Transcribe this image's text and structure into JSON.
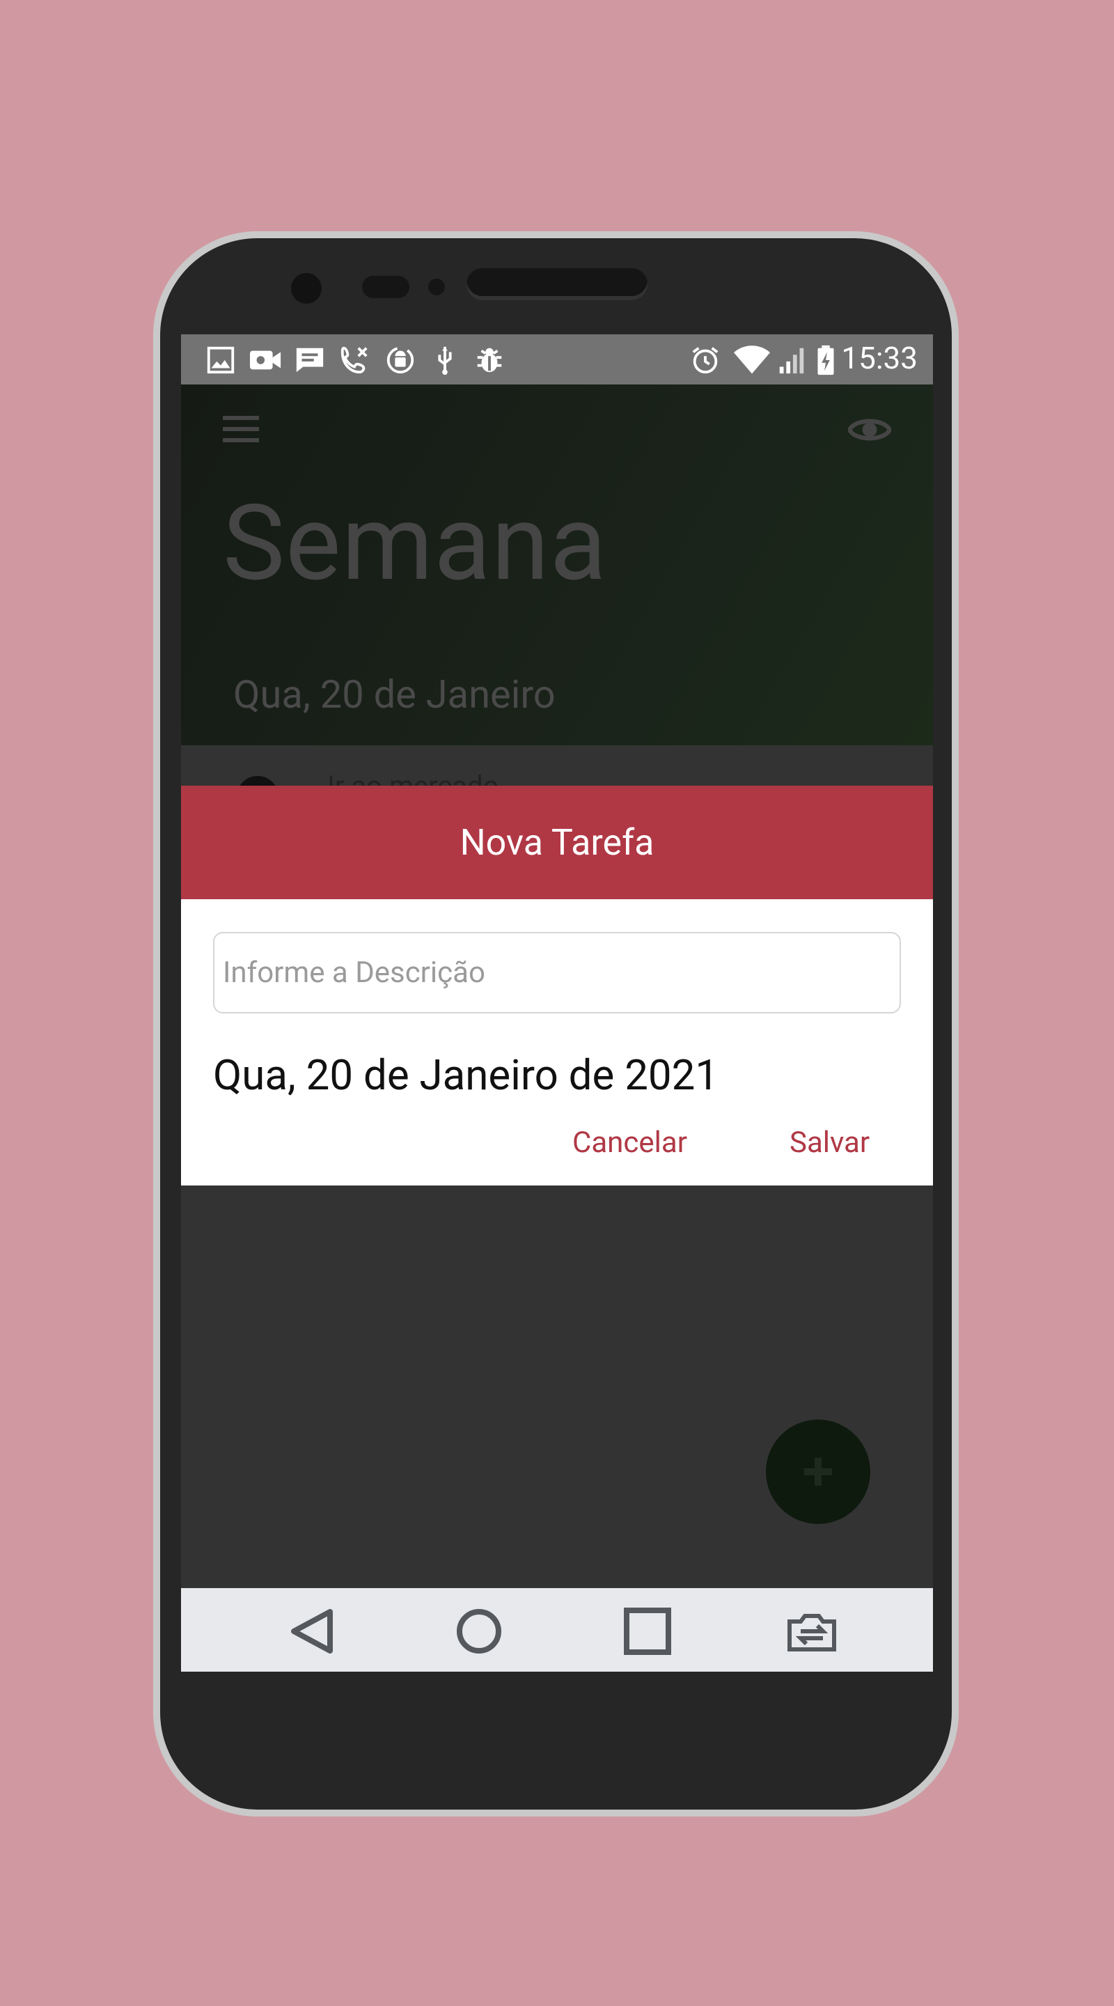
{
  "status_bar": {
    "time": "15:33",
    "left_icons": [
      "image-icon",
      "video-icon",
      "message-icon",
      "phone-missed-icon",
      "android-sync-icon",
      "usb-icon",
      "bug-icon"
    ],
    "right_icons": [
      "alarm-icon",
      "wifi-icon",
      "signal-icon",
      "battery-charging-icon"
    ]
  },
  "header": {
    "title": "Semana",
    "date": "Qua, 20 de Janeiro",
    "menu_icon": "menu-icon",
    "eye_icon": "eye-icon"
  },
  "list": {
    "peek_item": "Ir ao mercado"
  },
  "dialog": {
    "title": "Nova Tarefa",
    "description_placeholder": "Informe a Descrição",
    "description_value": "",
    "date": "Qua, 20 de Janeiro de 2021",
    "cancel_label": "Cancelar",
    "save_label": "Salvar"
  },
  "fab": {
    "icon": "plus-icon"
  },
  "navigation": {
    "icons": [
      "back-icon",
      "home-icon",
      "recents-icon",
      "rotate-icon"
    ]
  },
  "colors": {
    "background": "#d099a1",
    "accent": "#b03845",
    "dialog_header": "#b03845",
    "navbar": "#e8e9ec",
    "status_bar": "#737373"
  }
}
